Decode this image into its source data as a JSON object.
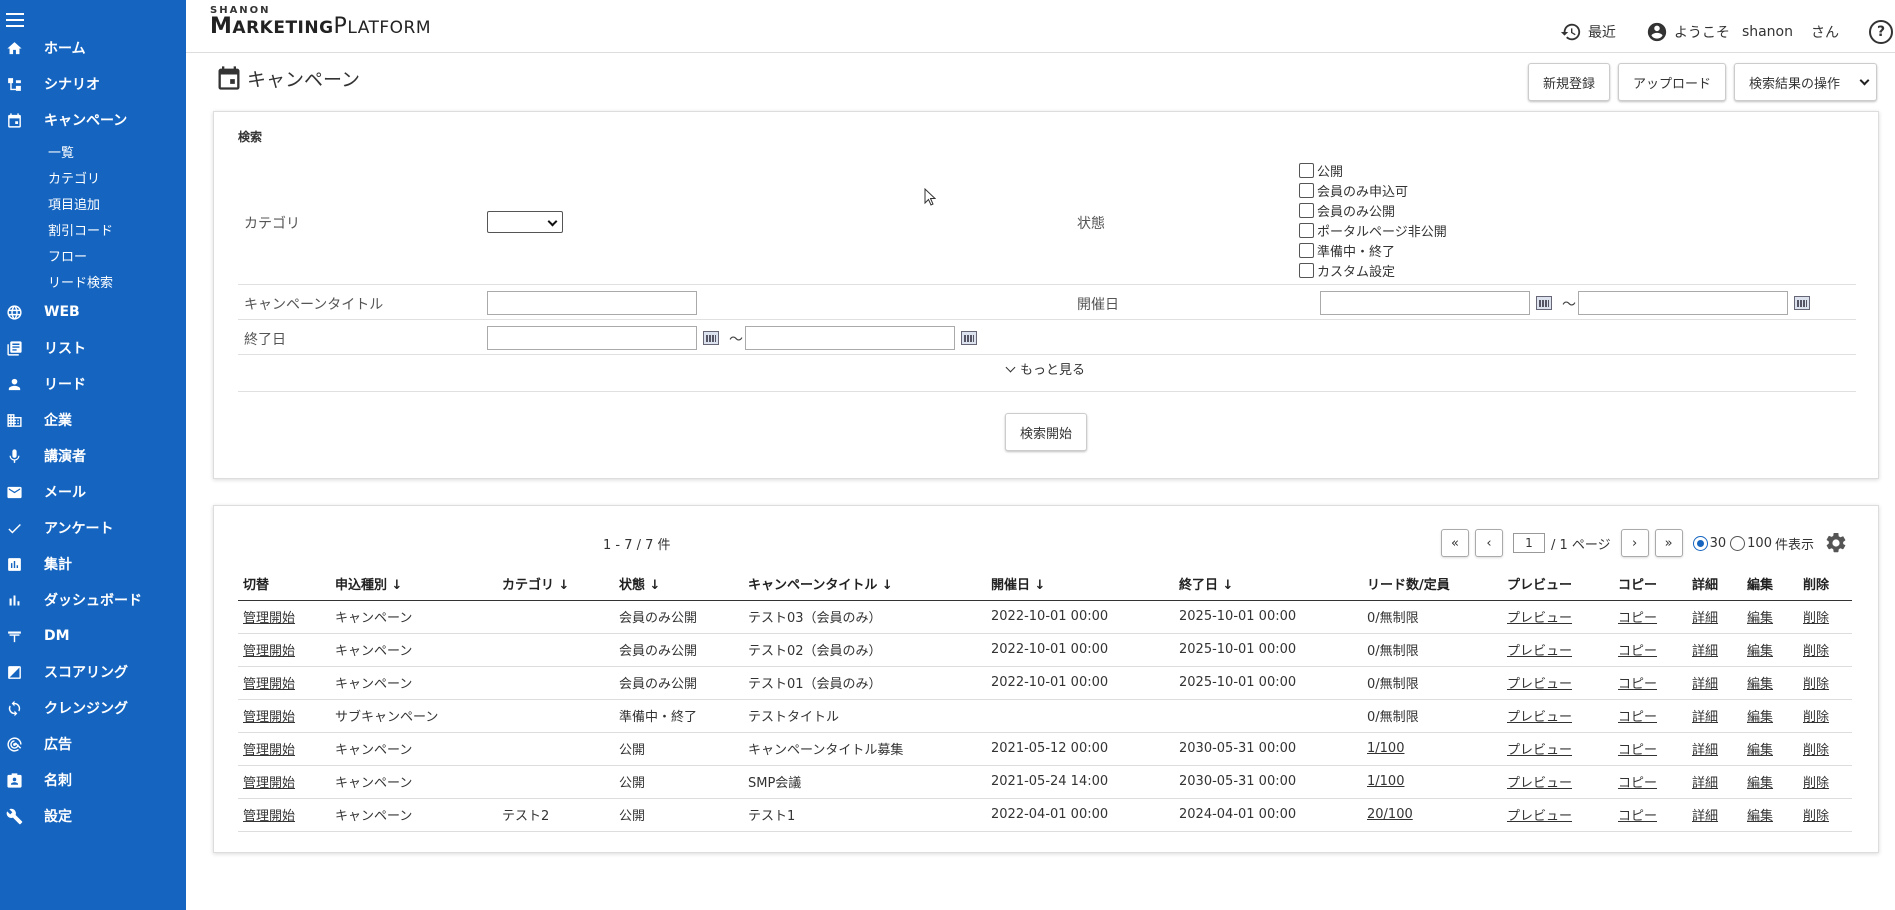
{
  "sidebar": {
    "items": [
      {
        "label": "ホーム",
        "icon": "home-icon"
      },
      {
        "label": "シナリオ",
        "icon": "scenario-icon"
      },
      {
        "label": "キャンペーン",
        "icon": "calendar-icon"
      },
      {
        "label": "WEB",
        "icon": "globe-icon"
      },
      {
        "label": "リスト",
        "icon": "list-icon"
      },
      {
        "label": "リード",
        "icon": "person-icon"
      },
      {
        "label": "企業",
        "icon": "building-icon"
      },
      {
        "label": "講演者",
        "icon": "microphone-icon"
      },
      {
        "label": "メール",
        "icon": "mail-icon"
      },
      {
        "label": "アンケート",
        "icon": "check-icon"
      },
      {
        "label": "集計",
        "icon": "report-icon"
      },
      {
        "label": "ダッシュボード",
        "icon": "bar-chart-icon"
      },
      {
        "label": "DM",
        "icon": "mailbox-icon"
      },
      {
        "label": "スコアリング",
        "icon": "scoring-icon"
      },
      {
        "label": "クレンジング",
        "icon": "cleansing-icon"
      },
      {
        "label": "広告",
        "icon": "ad-icon"
      },
      {
        "label": "名刺",
        "icon": "card-icon"
      },
      {
        "label": "設定",
        "icon": "wrench-icon"
      }
    ],
    "sub_items": [
      "一覧",
      "カテゴリ",
      "項目追加",
      "割引コード",
      "フロー",
      "リード検索"
    ]
  },
  "header": {
    "logo_small": "SHANON",
    "logo_big_1": "M",
    "logo_big_2": "ARKETING",
    "logo_big_3": "P",
    "logo_big_4": "LATFORM",
    "recent": "最近",
    "welcome": "ようこそ",
    "username": "shanon",
    "honorific": "さん",
    "help": "?"
  },
  "page": {
    "title": "キャンペーン",
    "new_button": "新規登録",
    "upload_button": "アップロード",
    "search_ops": "検索結果の操作"
  },
  "search": {
    "title": "検索",
    "category_label": "カテゴリ",
    "status_label": "状態",
    "status_options": [
      "公開",
      "会員のみ申込可",
      "会員のみ公開",
      "ポータルページ非公開",
      "準備中・終了",
      "カスタム設定"
    ],
    "campaign_title_label": "キャンペーンタイトル",
    "start_date_label": "開催日",
    "end_date_label": "終了日",
    "tilde": "～",
    "more": "もっと見る",
    "search_button": "検索開始"
  },
  "results": {
    "count": "1 - 7 / 7 件",
    "page_value": "1",
    "page_suffix": "/ 1 ページ",
    "first": "«",
    "prev": "‹",
    "next": "›",
    "last": "»",
    "per_page_30": "30",
    "per_page_100": "100",
    "per_page_suffix": "件表示",
    "columns": [
      "切替",
      "申込種別 ↓",
      "カテゴリ ↓",
      "状態 ↓",
      "キャンペーンタイトル ↓",
      "開催日 ↓",
      "終了日 ↓",
      "リード数/定員",
      "プレビュー",
      "コピー",
      "詳細",
      "編集",
      "削除"
    ],
    "rows": [
      {
        "toggle": "管理開始",
        "type": "キャンペーン",
        "category": "",
        "status": "会員のみ公開",
        "title": "テスト03（会員のみ）",
        "start": "2022-10-01 00:00",
        "end": "2025-10-01 00:00",
        "leads": "0/無制限",
        "leads_link": false,
        "preview": "プレビュー",
        "copy": "コピー",
        "detail": "詳細",
        "edit": "編集",
        "delete": "削除"
      },
      {
        "toggle": "管理開始",
        "type": "キャンペーン",
        "category": "",
        "status": "会員のみ公開",
        "title": "テスト02（会員のみ）",
        "start": "2022-10-01 00:00",
        "end": "2025-10-01 00:00",
        "leads": "0/無制限",
        "leads_link": false,
        "preview": "プレビュー",
        "copy": "コピー",
        "detail": "詳細",
        "edit": "編集",
        "delete": "削除"
      },
      {
        "toggle": "管理開始",
        "type": "キャンペーン",
        "category": "",
        "status": "会員のみ公開",
        "title": "テスト01（会員のみ）",
        "start": "2022-10-01 00:00",
        "end": "2025-10-01 00:00",
        "leads": "0/無制限",
        "leads_link": false,
        "preview": "プレビュー",
        "copy": "コピー",
        "detail": "詳細",
        "edit": "編集",
        "delete": "削除"
      },
      {
        "toggle": "管理開始",
        "type": "サブキャンペーン",
        "category": "",
        "status": "準備中・終了",
        "title": "テストタイトル",
        "start": "",
        "end": "",
        "leads": "0/無制限",
        "leads_link": false,
        "preview": "プレビュー",
        "copy": "コピー",
        "detail": "詳細",
        "edit": "編集",
        "delete": "削除"
      },
      {
        "toggle": "管理開始",
        "type": "キャンペーン",
        "category": "",
        "status": "公開",
        "title": "キャンペーンタイトル募集",
        "start": "2021-05-12 00:00",
        "end": "2030-05-31 00:00",
        "leads": "1/100",
        "leads_link": true,
        "preview": "プレビュー",
        "copy": "コピー",
        "detail": "詳細",
        "edit": "編集",
        "delete": "削除"
      },
      {
        "toggle": "管理開始",
        "type": "キャンペーン",
        "category": "",
        "status": "公開",
        "title": "SMP会議",
        "start": "2021-05-24 14:00",
        "end": "2030-05-31 00:00",
        "leads": "1/100",
        "leads_link": true,
        "preview": "プレビュー",
        "copy": "コピー",
        "detail": "詳細",
        "edit": "編集",
        "delete": "削除"
      },
      {
        "toggle": "管理開始",
        "type": "キャンペーン",
        "category": "テスト2",
        "status": "公開",
        "title": "テスト1",
        "start": "2022-04-01 00:00",
        "end": "2024-04-01 00:00",
        "leads": "20/100",
        "leads_link": true,
        "preview": "プレビュー",
        "copy": "コピー",
        "detail": "詳細",
        "edit": "編集",
        "delete": "削除"
      }
    ]
  },
  "colors": {
    "sidebar": "#1565c0",
    "text": "#333333",
    "radio_accent": "#1565c0"
  }
}
